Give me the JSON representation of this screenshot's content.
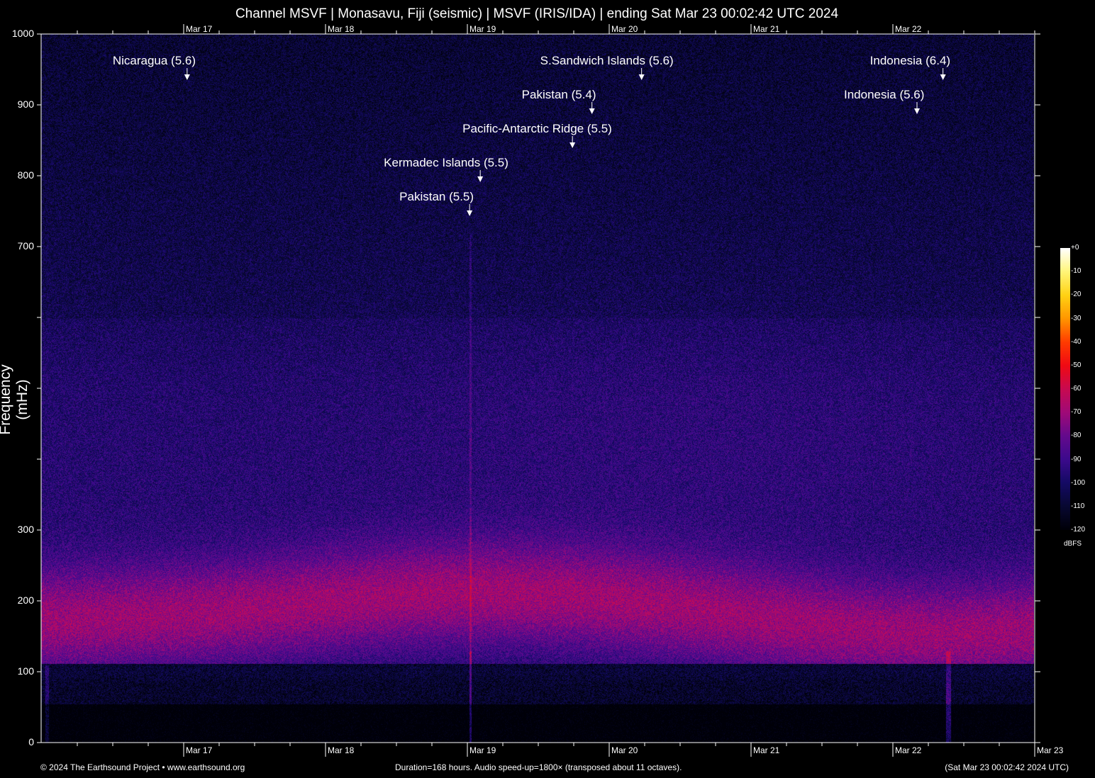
{
  "title": "Channel MSVF | Monasavu, Fiji (seismic) | MSVF (IRIS/IDA) | ending Sat Mar 23 00:02:42 UTC 2024",
  "chart_data": {
    "type": "heatmap",
    "title": "Channel MSVF | Monasavu, Fiji (seismic) | MSVF (IRIS/IDA) | ending Sat Mar 23 00:02:42 UTC 2024",
    "xlabel": "",
    "ylabel": "Frequency (mHz)",
    "xlim_hours": [
      0,
      168
    ],
    "ylim": [
      0,
      1000
    ],
    "y_ticks": [
      0,
      100,
      200,
      300,
      400,
      500,
      600,
      700,
      800,
      900,
      1000
    ],
    "y_tick_labels": [
      "0",
      "100",
      "200",
      "300",
      "",
      "",
      "",
      "700",
      "800",
      "900",
      "1000"
    ],
    "x_ticks": [
      {
        "label": "Mar 17",
        "hours": 24
      },
      {
        "label": "Mar 18",
        "hours": 48
      },
      {
        "label": "Mar 19",
        "hours": 72
      },
      {
        "label": "Mar 20",
        "hours": 96
      },
      {
        "label": "Mar 21",
        "hours": 120
      },
      {
        "label": "Mar 22",
        "hours": 144
      },
      {
        "label": "Mar 23",
        "hours": 168
      }
    ],
    "minor_tick_hours": 6,
    "events": [
      {
        "label": "Nicaragua (5.6)",
        "hours": 24.7
      },
      {
        "label": "S.Sandwich Islands (5.6)",
        "hours": 101.6
      },
      {
        "label": "Indonesia (6.4)",
        "hours": 152.6
      },
      {
        "label": "Pakistan (5.4)",
        "hours": 93.2
      },
      {
        "label": "Indonesia (5.6)",
        "hours": 148.2
      },
      {
        "label": "Pacific-Antarctic Ridge (5.5)",
        "hours": 89.9
      },
      {
        "label": "Kermadec Islands (5.5)",
        "hours": 74.3
      },
      {
        "label": "Pakistan (5.5)",
        "hours": 72.5
      }
    ],
    "colorbar": {
      "unit": "dBFS",
      "range": [
        -120,
        0
      ],
      "tick_labels": [
        "+0",
        "-10",
        "-20",
        "-30",
        "-40",
        "-50",
        "-60",
        "-70",
        "-80",
        "-90",
        "-100",
        "-110",
        "-120"
      ]
    }
  },
  "footer": {
    "copyright": "© 2024 The Earthsound Project • www.earthsound.org",
    "info": "Duration=168 hours. Audio speed-up=1800× (transposed about 11 octaves).",
    "timestamp": "(Sat Mar 23 00:02:42 2024 UTC)"
  }
}
